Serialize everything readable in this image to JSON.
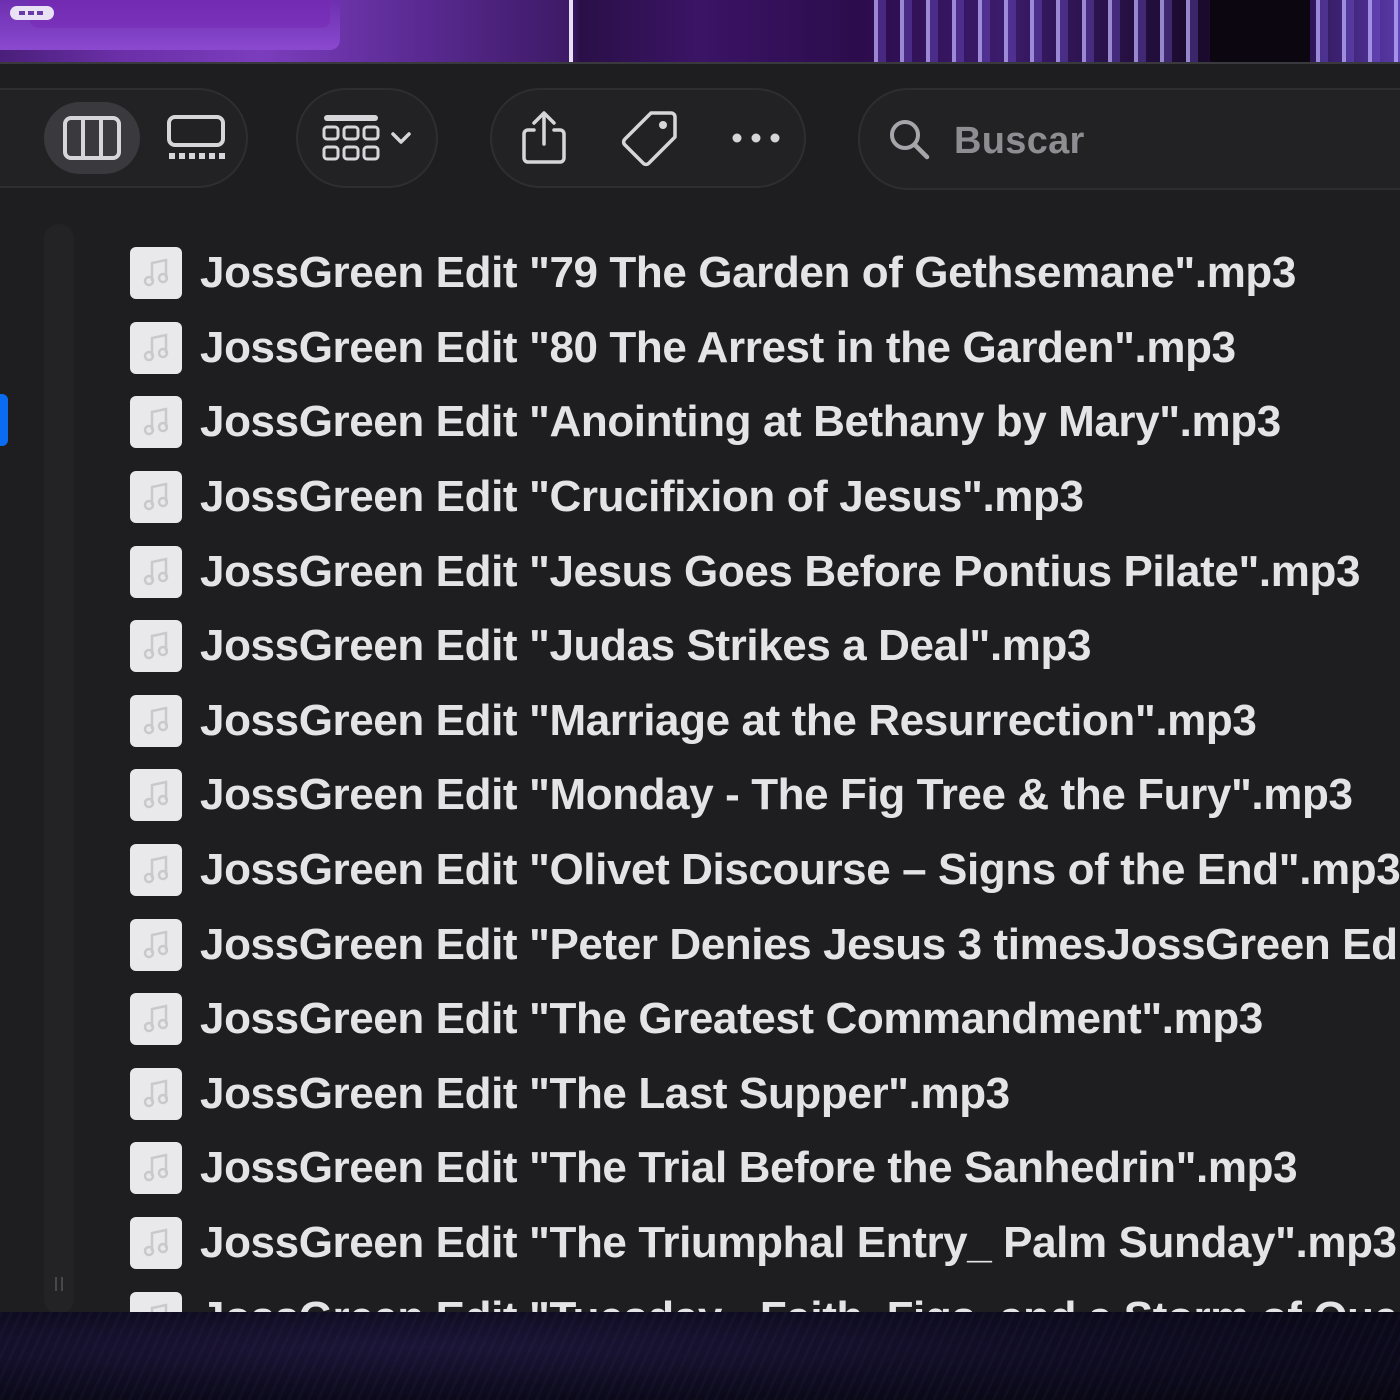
{
  "toolbar": {
    "view_buttons": [
      "list-view-icon",
      "column-view-icon",
      "gallery-view-icon"
    ],
    "group_button": "group-icon",
    "share_button": "share-icon",
    "tag_button": "tag-icon",
    "more_button": "ellipsis-icon",
    "search": {
      "placeholder": "Buscar"
    }
  },
  "files": [
    {
      "icon": "audio-file-icon",
      "name": "JossGreen Edit \"79 The Garden of Gethsemane\".mp3"
    },
    {
      "icon": "audio-file-icon",
      "name": "JossGreen Edit \"80 The Arrest in the Garden\".mp3"
    },
    {
      "icon": "audio-file-icon",
      "name": "JossGreen Edit \"Anointing at Bethany by Mary\".mp3"
    },
    {
      "icon": "audio-file-icon",
      "name": "JossGreen Edit \"Crucifixion of Jesus\".mp3"
    },
    {
      "icon": "audio-file-icon",
      "name": "JossGreen Edit \"Jesus Goes Before Pontius Pilate\".mp3"
    },
    {
      "icon": "audio-file-icon",
      "name": "JossGreen Edit \"Judas Strikes a Deal\".mp3"
    },
    {
      "icon": "audio-file-icon",
      "name": "JossGreen Edit \"Marriage at the Resurrection\".mp3"
    },
    {
      "icon": "audio-file-icon",
      "name": "JossGreen Edit \"Monday - The Fig Tree & the Fury\".mp3"
    },
    {
      "icon": "audio-file-icon",
      "name": "JossGreen Edit \"Olivet Discourse – Signs of the End\".mp3"
    },
    {
      "icon": "audio-file-icon",
      "name": "JossGreen Edit \"Peter Denies Jesus 3 timesJossGreen Ed"
    },
    {
      "icon": "audio-file-icon",
      "name": "JossGreen Edit \"The Greatest Commandment\".mp3"
    },
    {
      "icon": "audio-file-icon",
      "name": "JossGreen Edit \"The Last Supper\".mp3"
    },
    {
      "icon": "audio-file-icon",
      "name": "JossGreen Edit \"The Trial Before the Sanhedrin\".mp3"
    },
    {
      "icon": "audio-file-icon",
      "name": "JossGreen Edit \"The Triumphal Entry_ Palm Sunday\".mp3"
    },
    {
      "icon": "audio-file-icon",
      "name": "JossGreen Edit \"Tuesday - Faith, Figs, and a Storm of Que"
    }
  ],
  "colors": {
    "window_bg": "#1e1e21",
    "text": "#e4e4e6",
    "selection_accent": "#0a6cf0",
    "placeholder": "#8d8d92"
  }
}
